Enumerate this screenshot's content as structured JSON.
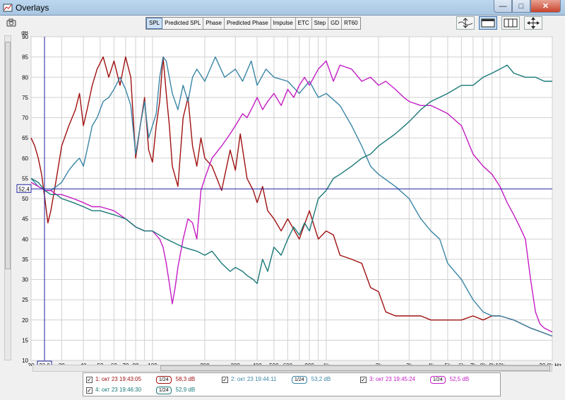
{
  "window": {
    "title": "Overlays"
  },
  "tabs": [
    "SPL",
    "Predicted SPL",
    "Phase",
    "Predicted Phase",
    "Impulse",
    "ETC",
    "Step",
    "GD",
    "RT60"
  ],
  "active_tab": "SPL",
  "cursor": {
    "y_readout": "52,4",
    "x_readout": "23,9"
  },
  "chart_data": {
    "type": "line",
    "ylabel": "dB",
    "xunit": "Hz",
    "ylim": [
      10,
      90
    ],
    "xlim": [
      20,
      20000
    ],
    "xscale": "log",
    "grid": true,
    "yticks": [
      "10",
      "15",
      "20",
      "25",
      "30",
      "35",
      "40",
      "45",
      "50",
      "55",
      "60",
      "65",
      "70",
      "75",
      "80",
      "85",
      "90"
    ],
    "xticks": [
      {
        "v": 20,
        "label": "20"
      },
      {
        "v": 30,
        "label": "30"
      },
      {
        "v": 40,
        "label": "40"
      },
      {
        "v": 50,
        "label": "50"
      },
      {
        "v": 60,
        "label": "60"
      },
      {
        "v": 70,
        "label": "70"
      },
      {
        "v": 80,
        "label": "80"
      },
      {
        "v": 100,
        "label": "100"
      },
      {
        "v": 200,
        "label": "200"
      },
      {
        "v": 300,
        "label": "300"
      },
      {
        "v": 400,
        "label": "400"
      },
      {
        "v": 500,
        "label": "500"
      },
      {
        "v": 600,
        "label": "600"
      },
      {
        "v": 800,
        "label": "800"
      },
      {
        "v": 1000,
        "label": "1k"
      },
      {
        "v": 2000,
        "label": "2k"
      },
      {
        "v": 3000,
        "label": "3k"
      },
      {
        "v": 4000,
        "label": "4k"
      },
      {
        "v": 5000,
        "label": "5k"
      },
      {
        "v": 6000,
        "label": "6k"
      },
      {
        "v": 7000,
        "label": "7k"
      },
      {
        "v": 8000,
        "label": "8k"
      },
      {
        "v": 9000,
        "label": "9k"
      },
      {
        "v": 10000,
        "label": "10k"
      },
      {
        "v": 20000,
        "label": "20,0k Hz"
      }
    ],
    "minor_x": [
      90,
      700,
      900
    ],
    "cursor_x": 23.9,
    "cursor_y": 52.4,
    "series": [
      {
        "name": "1: окт 23 19:43:05",
        "color": "#a01010",
        "points": [
          [
            20,
            65
          ],
          [
            21,
            63
          ],
          [
            22,
            60
          ],
          [
            23,
            56
          ],
          [
            24,
            50
          ],
          [
            25,
            44
          ],
          [
            26,
            47
          ],
          [
            28,
            55
          ],
          [
            30,
            63
          ],
          [
            33,
            68
          ],
          [
            36,
            72
          ],
          [
            38,
            76
          ],
          [
            40,
            68
          ],
          [
            42,
            72
          ],
          [
            45,
            78
          ],
          [
            48,
            82
          ],
          [
            52,
            85
          ],
          [
            56,
            80
          ],
          [
            60,
            84
          ],
          [
            65,
            78
          ],
          [
            70,
            85
          ],
          [
            75,
            80
          ],
          [
            80,
            60
          ],
          [
            85,
            68
          ],
          [
            90,
            75
          ],
          [
            95,
            62
          ],
          [
            100,
            59
          ],
          [
            105,
            68
          ],
          [
            110,
            74
          ],
          [
            115,
            85
          ],
          [
            120,
            76
          ],
          [
            125,
            68
          ],
          [
            130,
            58
          ],
          [
            140,
            53
          ],
          [
            150,
            70
          ],
          [
            160,
            75
          ],
          [
            170,
            63
          ],
          [
            180,
            58
          ],
          [
            190,
            65
          ],
          [
            200,
            60
          ],
          [
            220,
            58
          ],
          [
            250,
            52
          ],
          [
            280,
            62
          ],
          [
            300,
            57
          ],
          [
            320,
            66
          ],
          [
            350,
            55
          ],
          [
            380,
            52
          ],
          [
            400,
            49
          ],
          [
            430,
            53
          ],
          [
            460,
            47
          ],
          [
            500,
            45
          ],
          [
            550,
            42
          ],
          [
            600,
            45
          ],
          [
            700,
            40
          ],
          [
            800,
            47
          ],
          [
            900,
            40
          ],
          [
            1000,
            42
          ],
          [
            1100,
            41
          ],
          [
            1200,
            36
          ],
          [
            1400,
            35
          ],
          [
            1600,
            34
          ],
          [
            1800,
            28
          ],
          [
            2000,
            27
          ],
          [
            2200,
            22
          ],
          [
            2500,
            21
          ],
          [
            3000,
            21
          ],
          [
            3500,
            21
          ],
          [
            4000,
            20
          ],
          [
            5000,
            20
          ],
          [
            6000,
            20
          ],
          [
            7000,
            21
          ],
          [
            8000,
            20
          ],
          [
            9000,
            21
          ],
          [
            10000,
            21
          ],
          [
            12000,
            20
          ],
          [
            15000,
            18
          ],
          [
            20000,
            16
          ]
        ]
      },
      {
        "name": "2: окт 23 19:44:11",
        "color": "#3a86a6",
        "points": [
          [
            20,
            55
          ],
          [
            22,
            53
          ],
          [
            24,
            52
          ],
          [
            26,
            52
          ],
          [
            28,
            53
          ],
          [
            30,
            54
          ],
          [
            33,
            57
          ],
          [
            36,
            59
          ],
          [
            38,
            60
          ],
          [
            40,
            58
          ],
          [
            42,
            62
          ],
          [
            45,
            68
          ],
          [
            48,
            70
          ],
          [
            52,
            74
          ],
          [
            56,
            75
          ],
          [
            60,
            77
          ],
          [
            65,
            80
          ],
          [
            70,
            77
          ],
          [
            75,
            73
          ],
          [
            80,
            61
          ],
          [
            85,
            68
          ],
          [
            90,
            74
          ],
          [
            95,
            65
          ],
          [
            100,
            68
          ],
          [
            105,
            71
          ],
          [
            110,
            80
          ],
          [
            115,
            85
          ],
          [
            120,
            84
          ],
          [
            130,
            76
          ],
          [
            140,
            72
          ],
          [
            150,
            78
          ],
          [
            160,
            74
          ],
          [
            170,
            80
          ],
          [
            180,
            82
          ],
          [
            200,
            79
          ],
          [
            230,
            85
          ],
          [
            260,
            80
          ],
          [
            300,
            82
          ],
          [
            330,
            79
          ],
          [
            370,
            84
          ],
          [
            400,
            78
          ],
          [
            450,
            82
          ],
          [
            500,
            80
          ],
          [
            600,
            79
          ],
          [
            700,
            76
          ],
          [
            800,
            79
          ],
          [
            900,
            75
          ],
          [
            1000,
            76
          ],
          [
            1200,
            73
          ],
          [
            1400,
            68
          ],
          [
            1600,
            63
          ],
          [
            1800,
            58
          ],
          [
            2000,
            56
          ],
          [
            2500,
            53
          ],
          [
            3000,
            50
          ],
          [
            3500,
            45
          ],
          [
            4000,
            42
          ],
          [
            4500,
            40
          ],
          [
            5000,
            34
          ],
          [
            6000,
            30
          ],
          [
            7000,
            25
          ],
          [
            8000,
            22
          ],
          [
            9000,
            21
          ],
          [
            10000,
            21
          ],
          [
            12000,
            20
          ],
          [
            15000,
            18
          ],
          [
            20000,
            16
          ]
        ]
      },
      {
        "name": "3: окт 23 19:45:24",
        "color": "#c41cc4",
        "points": [
          [
            20,
            54
          ],
          [
            22,
            53
          ],
          [
            24,
            52
          ],
          [
            26,
            52
          ],
          [
            28,
            51
          ],
          [
            30,
            51
          ],
          [
            35,
            50
          ],
          [
            40,
            49
          ],
          [
            45,
            48
          ],
          [
            50,
            48
          ],
          [
            60,
            47
          ],
          [
            70,
            45
          ],
          [
            80,
            43
          ],
          [
            90,
            42
          ],
          [
            100,
            42
          ],
          [
            110,
            40
          ],
          [
            115,
            38
          ],
          [
            120,
            34
          ],
          [
            125,
            29
          ],
          [
            130,
            24
          ],
          [
            135,
            28
          ],
          [
            140,
            33
          ],
          [
            150,
            40
          ],
          [
            160,
            45
          ],
          [
            170,
            44
          ],
          [
            180,
            40
          ],
          [
            190,
            52
          ],
          [
            200,
            55
          ],
          [
            220,
            60
          ],
          [
            250,
            63
          ],
          [
            280,
            66
          ],
          [
            300,
            68
          ],
          [
            330,
            71
          ],
          [
            350,
            70
          ],
          [
            380,
            73
          ],
          [
            400,
            75
          ],
          [
            430,
            72
          ],
          [
            460,
            74
          ],
          [
            500,
            76
          ],
          [
            550,
            73
          ],
          [
            600,
            77
          ],
          [
            650,
            75
          ],
          [
            700,
            78
          ],
          [
            750,
            80
          ],
          [
            800,
            78
          ],
          [
            900,
            82
          ],
          [
            1000,
            84
          ],
          [
            1100,
            79
          ],
          [
            1200,
            83
          ],
          [
            1400,
            82
          ],
          [
            1600,
            79
          ],
          [
            1800,
            80
          ],
          [
            2000,
            78
          ],
          [
            2200,
            79
          ],
          [
            2500,
            77
          ],
          [
            2800,
            75
          ],
          [
            3000,
            74
          ],
          [
            3500,
            73
          ],
          [
            4000,
            73
          ],
          [
            4500,
            72
          ],
          [
            5000,
            71
          ],
          [
            6000,
            68
          ],
          [
            7000,
            61
          ],
          [
            8000,
            58
          ],
          [
            9000,
            56
          ],
          [
            10000,
            53
          ],
          [
            11000,
            49
          ],
          [
            12000,
            46
          ],
          [
            13000,
            43
          ],
          [
            14000,
            40
          ],
          [
            15000,
            30
          ],
          [
            16000,
            22
          ],
          [
            17000,
            19
          ],
          [
            18000,
            18
          ],
          [
            20000,
            17
          ]
        ]
      },
      {
        "name": "4: окт 23 19:46:30",
        "color": "#1a7878",
        "points": [
          [
            20,
            55
          ],
          [
            22,
            54
          ],
          [
            24,
            52
          ],
          [
            26,
            51
          ],
          [
            28,
            51
          ],
          [
            30,
            50
          ],
          [
            35,
            49
          ],
          [
            40,
            48
          ],
          [
            45,
            47
          ],
          [
            50,
            47
          ],
          [
            60,
            46
          ],
          [
            70,
            45
          ],
          [
            80,
            43
          ],
          [
            90,
            42
          ],
          [
            100,
            42
          ],
          [
            120,
            40
          ],
          [
            150,
            38
          ],
          [
            180,
            37
          ],
          [
            200,
            36
          ],
          [
            220,
            37
          ],
          [
            250,
            34
          ],
          [
            280,
            32
          ],
          [
            300,
            33
          ],
          [
            330,
            32
          ],
          [
            350,
            31
          ],
          [
            380,
            30
          ],
          [
            400,
            29
          ],
          [
            430,
            35
          ],
          [
            460,
            32
          ],
          [
            500,
            38
          ],
          [
            550,
            36
          ],
          [
            600,
            40
          ],
          [
            650,
            43
          ],
          [
            700,
            41
          ],
          [
            750,
            44
          ],
          [
            800,
            42
          ],
          [
            900,
            50
          ],
          [
            1000,
            52
          ],
          [
            1100,
            55
          ],
          [
            1200,
            56
          ],
          [
            1400,
            58
          ],
          [
            1600,
            60
          ],
          [
            1800,
            61
          ],
          [
            2000,
            63
          ],
          [
            2500,
            66
          ],
          [
            3000,
            69
          ],
          [
            3500,
            72
          ],
          [
            4000,
            74
          ],
          [
            5000,
            76
          ],
          [
            6000,
            78
          ],
          [
            7000,
            78
          ],
          [
            8000,
            80
          ],
          [
            9000,
            81
          ],
          [
            10000,
            82
          ],
          [
            11000,
            83
          ],
          [
            12000,
            81
          ],
          [
            14000,
            80
          ],
          [
            16000,
            80
          ],
          [
            18000,
            79
          ],
          [
            20000,
            79
          ]
        ]
      }
    ]
  },
  "legend": [
    {
      "checked": true,
      "label": "1: окт 23 19:43:05",
      "smoothing": "1/24",
      "value": "58,3 dB",
      "color": "#a01010"
    },
    {
      "checked": true,
      "label": "2: окт 23 19:44:11",
      "smoothing": "1/24",
      "value": "53,2 dB",
      "color": "#3a86a6"
    },
    {
      "checked": true,
      "label": "3: окт 23 19:45:24",
      "smoothing": "1/24",
      "value": "52,5 dB",
      "color": "#c41cc4"
    },
    {
      "checked": true,
      "label": "4: окт 23 19:46:30",
      "smoothing": "1/24",
      "value": "52,9 dB",
      "color": "#1a7878"
    }
  ],
  "colors": {
    "grid": "#d0d0d0",
    "cursor": "#2020a0"
  }
}
